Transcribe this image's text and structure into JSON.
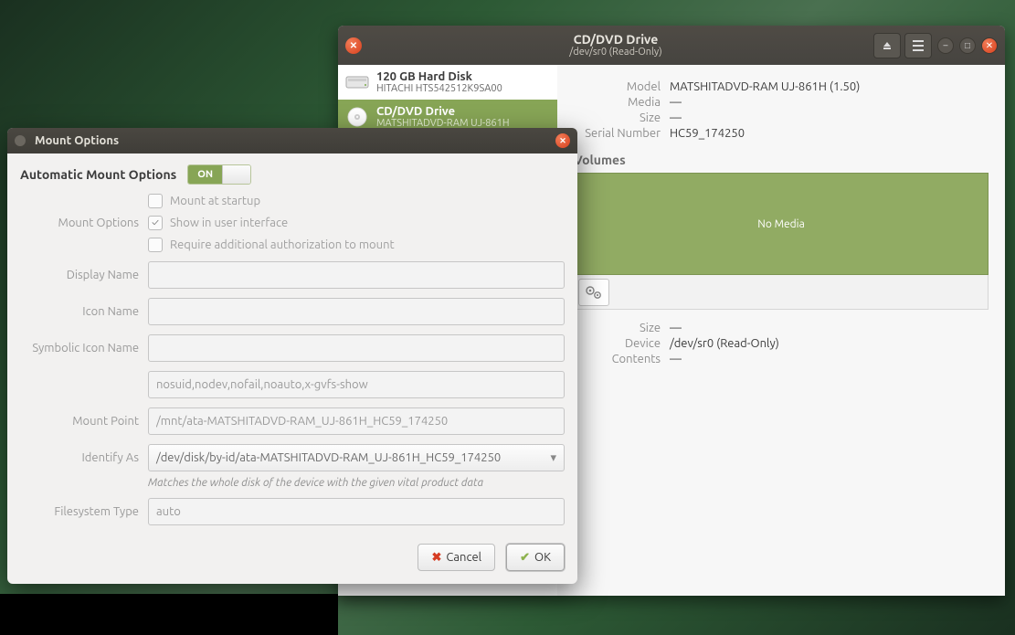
{
  "disks_window": {
    "title": "CD/DVD Drive",
    "subtitle": "/dev/sr0 (Read-Only)",
    "devices": [
      {
        "name": "120 GB Hard Disk",
        "model": "HITACHI HTS542512K9SA00",
        "selected": false,
        "icon": "hdd"
      },
      {
        "name": "CD/DVD Drive",
        "model": "MATSHITADVD-RAM UJ-861H",
        "selected": true,
        "icon": "cd"
      }
    ],
    "detail": {
      "model_label": "Model",
      "model_value": "MATSHITADVD-RAM UJ-861H (1.50)",
      "media_label": "Media",
      "media_value": "—",
      "size_label": "Size",
      "size_value": "—",
      "serial_label": "Serial Number",
      "serial_value": "HC59_174250",
      "volumes_header": "Volumes",
      "no_media": "No Media",
      "size2_label": "Size",
      "size2_value": "—",
      "device_label": "Device",
      "device_value": "/dev/sr0 (Read-Only)",
      "contents_label": "Contents",
      "contents_value": "—"
    }
  },
  "dialog": {
    "title": "Mount Options",
    "auto_label": "Automatic Mount Options",
    "switch_state": "ON",
    "mount_options_label": "Mount Options",
    "cb_startup": "Mount at startup",
    "cb_show_ui": "Show in user interface",
    "cb_auth": "Require additional authorization to mount",
    "display_name_label": "Display Name",
    "display_name_value": "",
    "icon_name_label": "Icon Name",
    "icon_name_value": "",
    "symbolic_icon_label": "Symbolic Icon Name",
    "symbolic_icon_value": "",
    "options_value": "nosuid,nodev,nofail,noauto,x-gvfs-show",
    "mount_point_label": "Mount Point",
    "mount_point_value": "/mnt/ata-MATSHITADVD-RAM_UJ-861H_HC59_174250",
    "identify_as_label": "Identify As",
    "identify_as_value": "/dev/disk/by-id/ata-MATSHITADVD-RAM_UJ-861H_HC59_174250",
    "identify_helper": "Matches the whole disk of the device with the given vital product data",
    "fs_type_label": "Filesystem Type",
    "fs_type_value": "auto",
    "cancel": "Cancel",
    "ok": "OK"
  }
}
